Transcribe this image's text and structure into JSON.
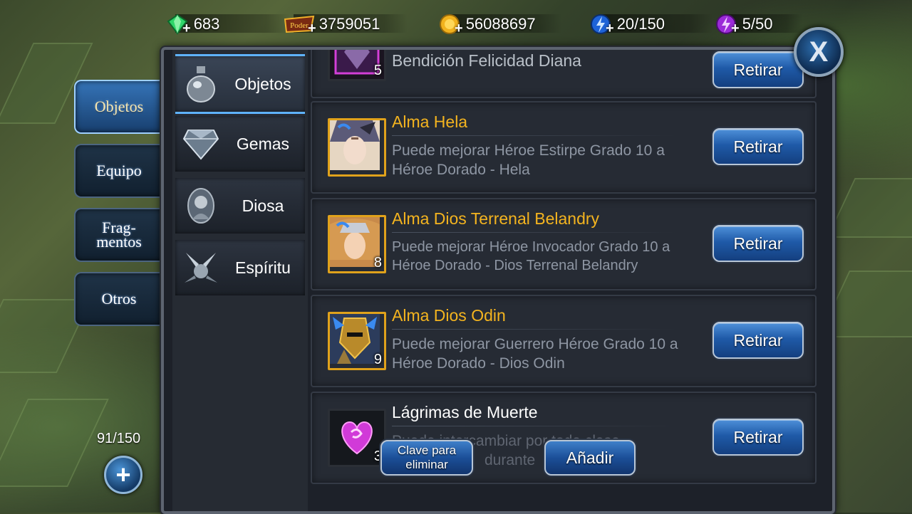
{
  "currencies": [
    {
      "icon": "green-gem-icon",
      "value": "683"
    },
    {
      "icon": "poder-icon",
      "icon_text": "Poder",
      "value": "3759051"
    },
    {
      "icon": "gold-coin-icon",
      "value": "56088697"
    },
    {
      "icon": "blue-energy-icon",
      "value": "20/150"
    },
    {
      "icon": "purple-energy-icon",
      "value": "5/50"
    }
  ],
  "side_tabs": [
    {
      "label": "Objetos",
      "active": true
    },
    {
      "label": "Equipo",
      "active": false
    },
    {
      "label": "Frag-\nmentos",
      "active": false
    },
    {
      "label": "Otros",
      "active": false
    }
  ],
  "bag_count": "91/150",
  "categories": [
    {
      "label": "Objetos",
      "icon": "potion-icon",
      "active": true
    },
    {
      "label": "Gemas",
      "icon": "diamond-icon",
      "active": false
    },
    {
      "label": "Diosa",
      "icon": "goddess-icon",
      "active": false
    },
    {
      "label": "Espíritu",
      "icon": "spirit-icon",
      "active": false
    }
  ],
  "items": [
    {
      "name": "Bendición Felicidad Diana",
      "qty": "5",
      "button": "Retirar"
    },
    {
      "name": "Alma Hela",
      "desc": "Puede mejorar Héroe Estirpe Grado 10 a Héroe Dorado - Hela",
      "qty": "",
      "button": "Retirar"
    },
    {
      "name": "Alma Dios Terrenal Belandry",
      "desc": "Puede mejorar Héroe Invocador Grado 10 a Héroe Dorado - Dios Terrenal Belandry",
      "qty": "8",
      "button": "Retirar"
    },
    {
      "name": "Alma Dios Odin",
      "desc": "Puede mejorar Guerrero Héroe Grado 10 a Héroe Dorado - Dios Odin",
      "qty": "9",
      "button": "Retirar"
    },
    {
      "name": "Lágrimas de Muerte",
      "desc": "Puede intercambiar por toda clase",
      "desc2": "durante",
      "qty": "3",
      "button": "Retirar"
    }
  ],
  "overlay_buttons": {
    "delete": "Clave para eliminar",
    "add": "Añadir"
  },
  "close_label": "X",
  "add_label": "+"
}
